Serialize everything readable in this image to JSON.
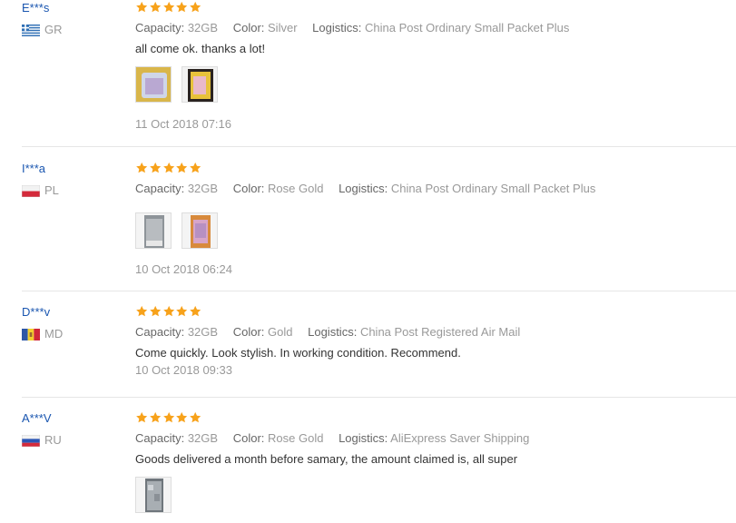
{
  "labels": {
    "capacity": "Capacity:",
    "color": "Color:",
    "logistics": "Logistics:"
  },
  "colors": {
    "star": "#f7a21b",
    "username": "#1a56b0"
  },
  "reviews": [
    {
      "user": "E***s",
      "country": "GR",
      "flag_icon": "greece-flag-icon",
      "rating": 5,
      "capacity": "32GB",
      "color": "Silver",
      "logistics": "China Post Ordinary Small Packet Plus",
      "text": "all come ok. thanks a lot!",
      "photos": 2,
      "date": "11 Oct 2018 07:16"
    },
    {
      "user": "I***a",
      "country": "PL",
      "flag_icon": "poland-flag-icon",
      "rating": 5,
      "capacity": "32GB",
      "color": "Rose Gold",
      "logistics": "China Post Ordinary Small Packet Plus",
      "text": "",
      "photos": 2,
      "date": "10 Oct 2018 06:24"
    },
    {
      "user": "D***v",
      "country": "MD",
      "flag_icon": "moldova-flag-icon",
      "rating": 5,
      "capacity": "32GB",
      "color": "Gold",
      "logistics": "China Post Registered Air Mail",
      "text": "Come quickly. Look stylish. In working condition. Recommend.",
      "photos": 0,
      "date": "10 Oct 2018 09:33"
    },
    {
      "user": "A***V",
      "country": "RU",
      "flag_icon": "russia-flag-icon",
      "rating": 5,
      "capacity": "32GB",
      "color": "Rose Gold",
      "logistics": "AliExpress Saver Shipping",
      "text": "Goods delivered a month before samary, the amount claimed is, all super",
      "photos": 1,
      "date": ""
    }
  ]
}
